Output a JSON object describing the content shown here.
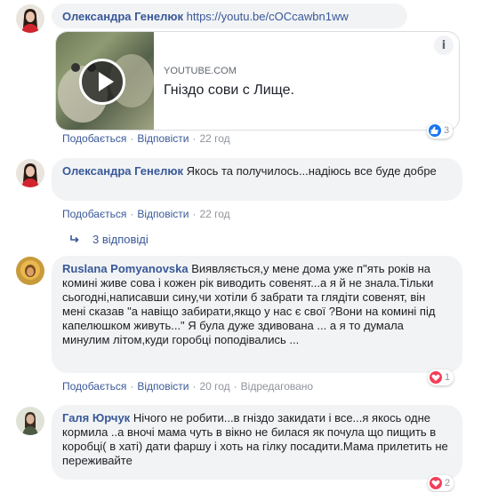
{
  "comments": [
    {
      "author": "Олександра Генелюк",
      "text": "https://youtu.be/cOCcawbn1ww",
      "link_card": {
        "site": "YOUTUBE.COM",
        "title": "Гніздо сови с Лище."
      },
      "actions": {
        "like": "Подобається",
        "reply": "Відповісти",
        "time": "22 год"
      },
      "reactions": {
        "icons": [
          "like-icon"
        ],
        "count": "3"
      }
    },
    {
      "author": "Олександра Генелюк",
      "text": "Якось та получилось...надіюсь все буде добре",
      "actions": {
        "like": "Подобається",
        "reply": "Відповісти",
        "time": "22 год"
      },
      "replies_label": "3 відповіді"
    },
    {
      "author": "Ruslana Pomyanovska",
      "text": "Виявляється,у мене дома уже п\"ять років на комині живе сова і кожен рік виводить совенят...а я й не знала.Тільки сьогодні,написавши сину,чи хотіли б забрати та глядіти совенят, він мені сказав \"а навіщо забирати,якщо у нас є свої ?Вони на комині під капелюшком живуть...\" Я була дуже здивована ... а я то думала минулим літом,куди горобці поподівались ...",
      "actions": {
        "like": "Подобається",
        "reply": "Відповісти",
        "time": "20 год",
        "edited": "Відредаговано"
      },
      "reactions": {
        "icons": [
          "love-icon"
        ],
        "count": "1"
      }
    },
    {
      "author": "Галя Юрчук",
      "text": "Нічого не робити...в гніздо закидати і все...я якось одне кормила ..а вночі мама чуть в вікно не билася як почула що пищить в коробці( в хаті) дати фаршу і хоть на гілку посадити.Мама прилетить не переживайте",
      "reactions": {
        "icons": [
          "love-icon"
        ],
        "count": "2"
      }
    }
  ],
  "colors": {
    "bubble": "#f2f3f5",
    "author": "#385898",
    "meta": "#90949c",
    "like": "#1877f2",
    "love": "#f33e58"
  }
}
